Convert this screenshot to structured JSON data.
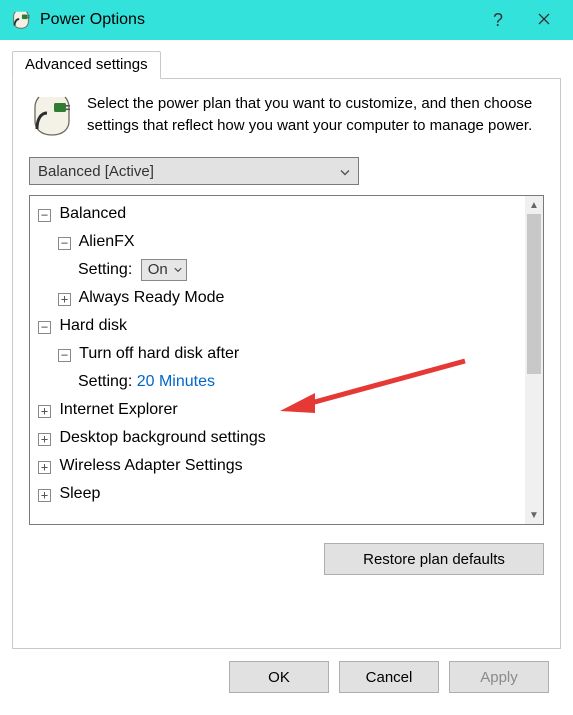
{
  "window": {
    "title": "Power Options",
    "help_tooltip": "?",
    "close_tooltip": "Close"
  },
  "tabs": {
    "advanced": "Advanced settings"
  },
  "intro_text": "Select the power plan that you want to customize, and then choose settings that reflect how you want your computer to manage power.",
  "plan_selector": {
    "selected": "Balanced [Active]"
  },
  "tree": {
    "balanced": {
      "label": "Balanced",
      "alienfx": {
        "label": "AlienFX",
        "setting_label": "Setting:",
        "setting_value": "On"
      },
      "always_ready": {
        "label": "Always Ready Mode"
      }
    },
    "hard_disk": {
      "label": "Hard disk",
      "turn_off": {
        "label": "Turn off hard disk after",
        "setting_label": "Setting:",
        "setting_value": "20 Minutes"
      }
    },
    "ie": {
      "label": "Internet Explorer"
    },
    "desktop_bg": {
      "label": "Desktop background settings"
    },
    "wireless": {
      "label": "Wireless Adapter Settings"
    },
    "sleep": {
      "label": "Sleep"
    }
  },
  "buttons": {
    "restore": "Restore plan defaults",
    "ok": "OK",
    "cancel": "Cancel",
    "apply": "Apply"
  }
}
